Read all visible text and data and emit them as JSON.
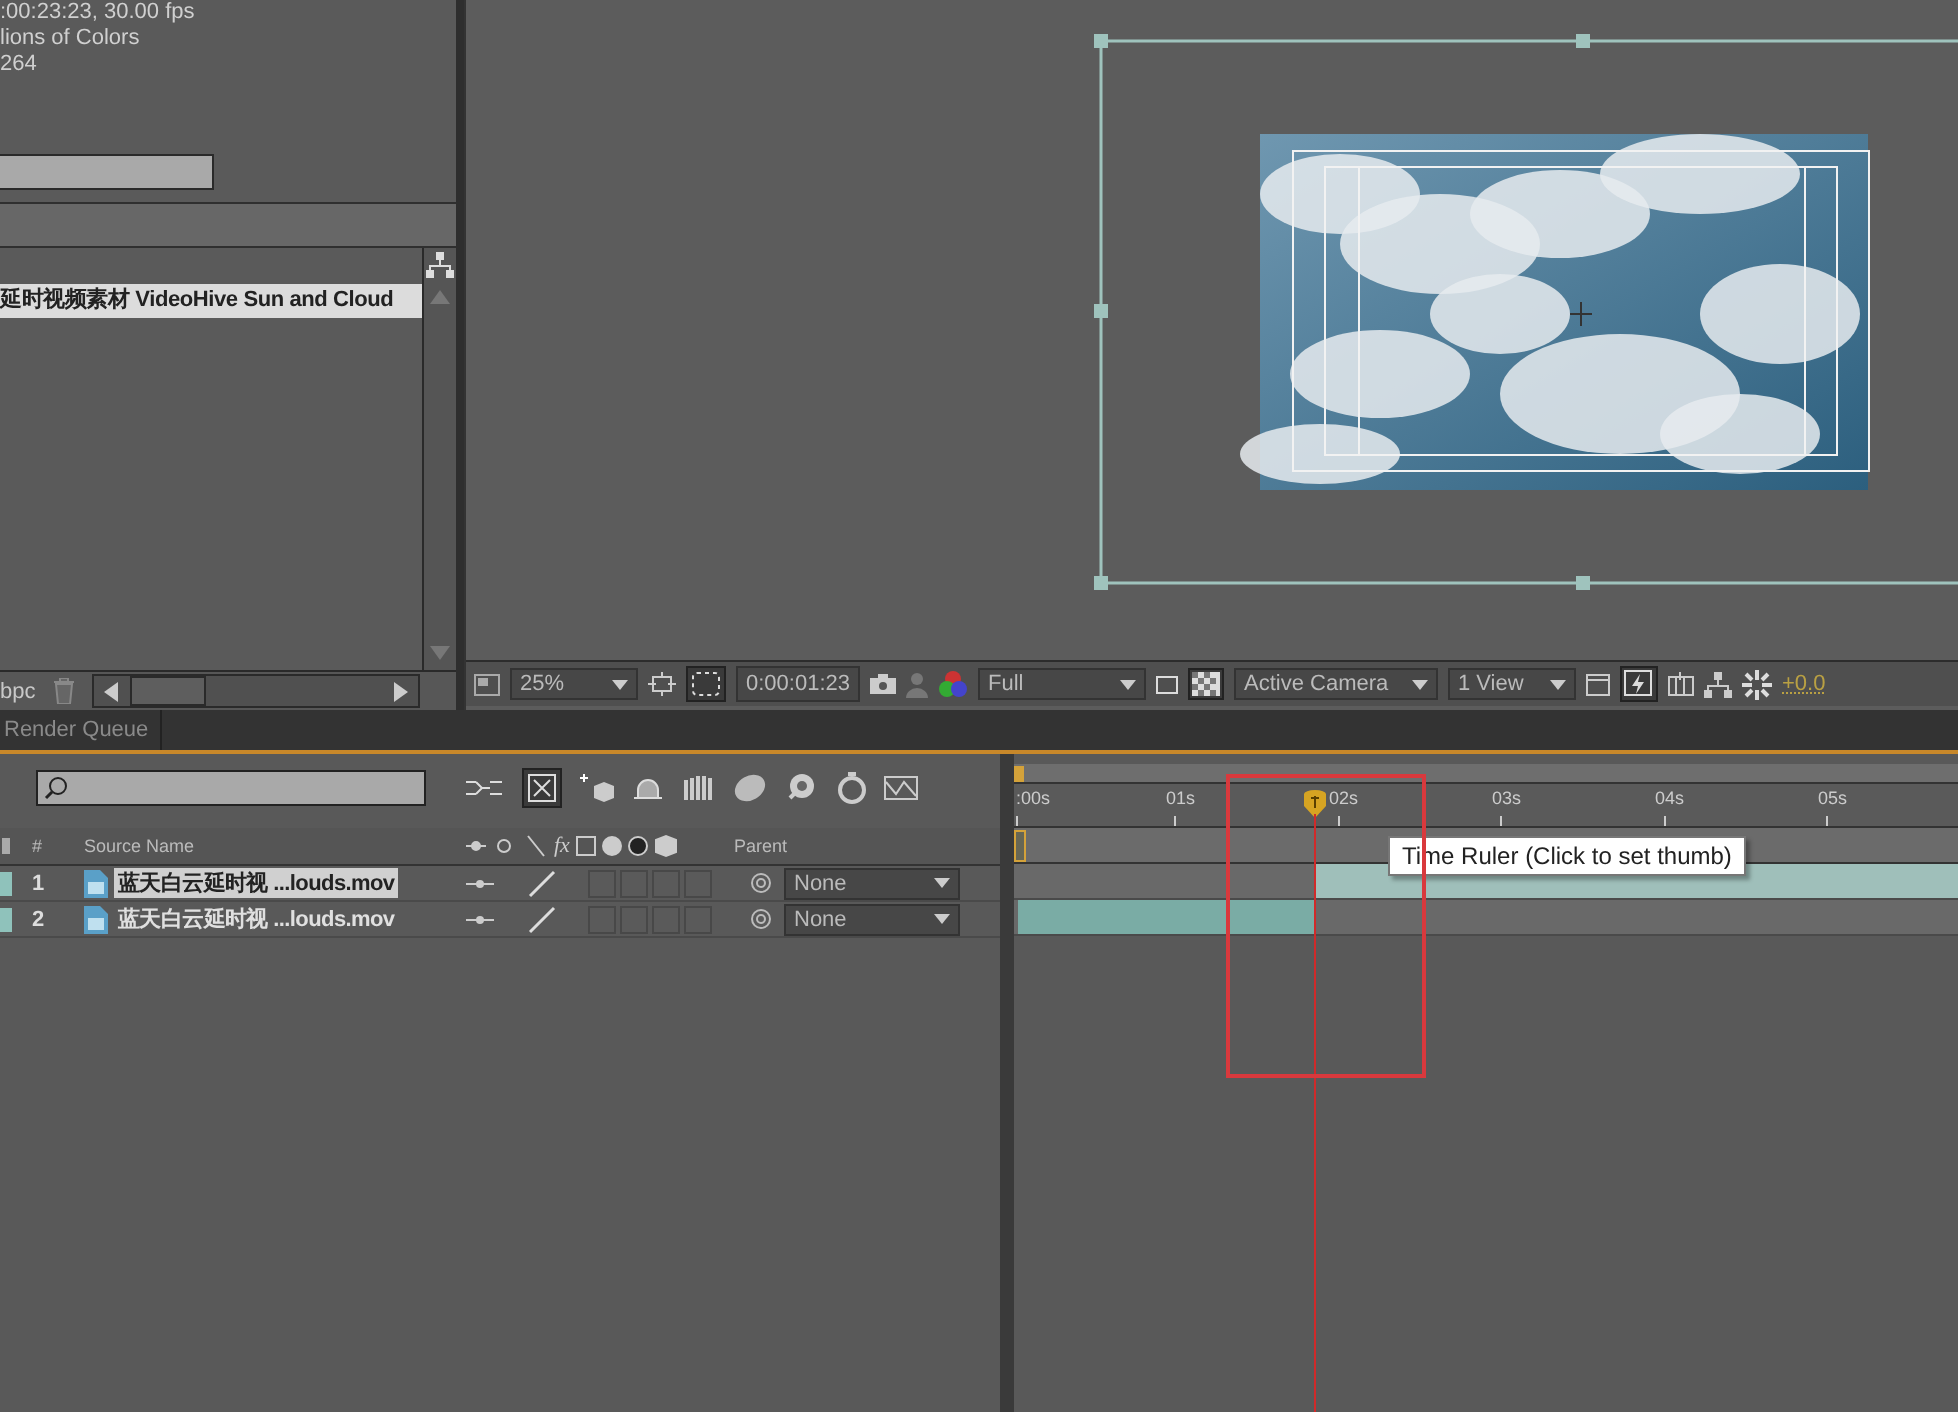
{
  "project_panel": {
    "info_lines": [
      ":00:23:23, 30.00 fps",
      "lions of Colors",
      "264"
    ],
    "items": [
      {
        "name": "延时视频素材 VideoHive Sun and Cloud",
        "selected": true
      }
    ],
    "bit_depth": "bpc"
  },
  "viewer": {
    "toolbar": {
      "zoom": "25%",
      "timecode": "0:00:01:23",
      "resolution": "Full",
      "camera": "Active Camera",
      "views": "1 View",
      "exposure": "+0.0"
    }
  },
  "timeline": {
    "tabs": [
      {
        "label": "Render Queue",
        "selected": false
      }
    ],
    "columns": {
      "number": "#",
      "source_name": "Source Name",
      "effects": "fx",
      "parent": "Parent"
    },
    "layers": [
      {
        "number": "1",
        "name": "蓝天白云延时视 ...louds.mov",
        "selected": true,
        "switches": [
          {
            "on": false
          },
          {
            "on": false
          },
          {
            "on": false
          },
          {
            "on": false
          }
        ],
        "parent": "None"
      },
      {
        "number": "2",
        "name": "蓝天白云延时视 ...louds.mov",
        "selected": false,
        "switches": [
          {
            "on": false
          },
          {
            "on": false
          },
          {
            "on": false
          },
          {
            "on": false
          }
        ],
        "parent": "None"
      }
    ],
    "ruler_labels": [
      ":00s",
      "01s",
      "02s",
      "03s",
      "04s",
      "05s"
    ],
    "tooltip": "Time Ruler (Click to set thumb)"
  }
}
